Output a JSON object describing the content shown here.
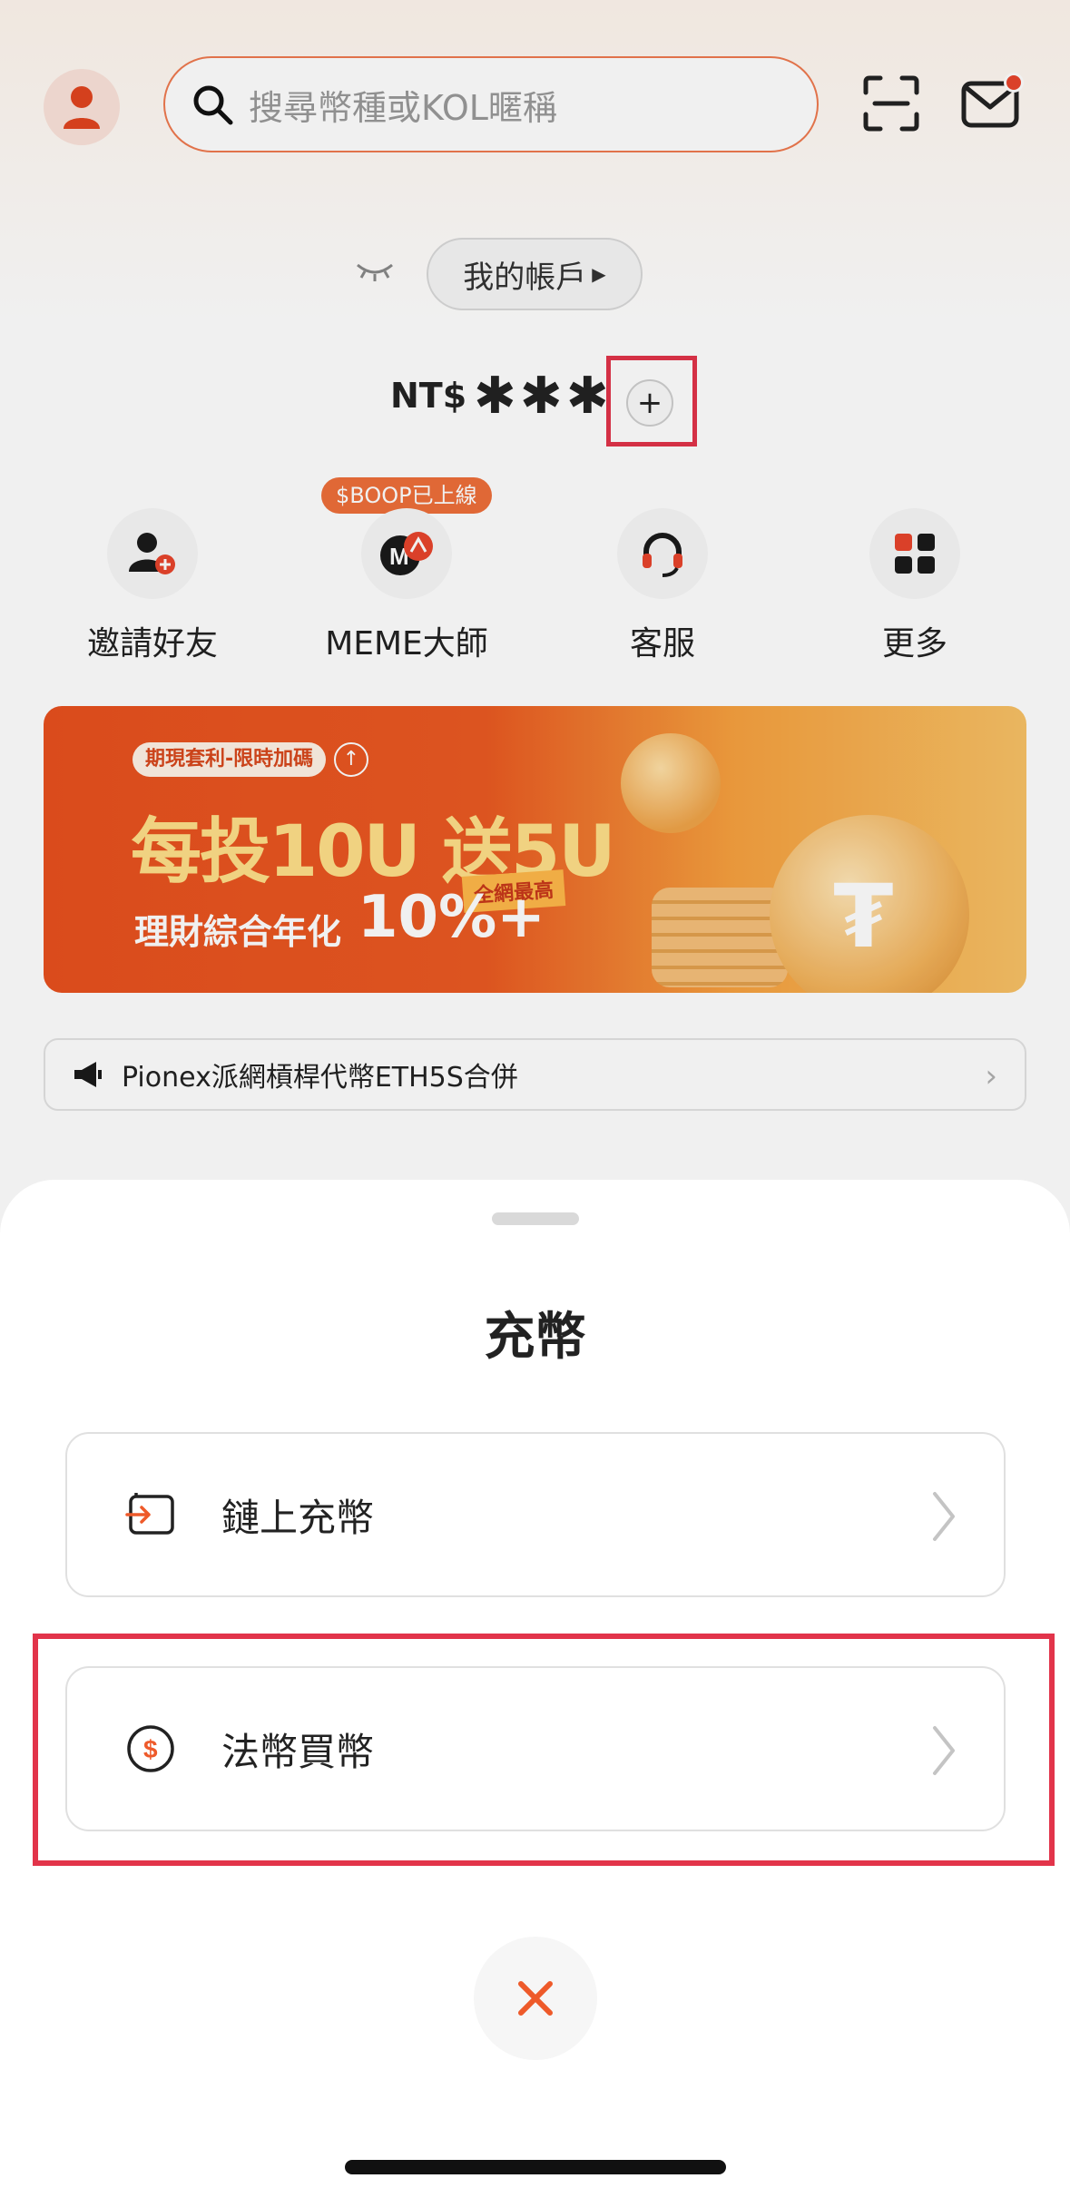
{
  "header": {
    "search_placeholder": "搜尋幣種或KOL暱稱"
  },
  "account": {
    "button_label": "我的帳戶",
    "currency": "NT$",
    "balance_masked": "✱✱✱",
    "plus_symbol": "+"
  },
  "quick_actions": {
    "badge": "$BOOP已上線",
    "items": [
      {
        "label": "邀請好友",
        "icon": "invite-friend-icon"
      },
      {
        "label": "MEME大師",
        "icon": "meme-master-icon"
      },
      {
        "label": "客服",
        "icon": "headset-icon"
      },
      {
        "label": "更多",
        "icon": "grid-icon"
      }
    ]
  },
  "banner": {
    "tag": "期現套利-限時加碼",
    "headline": "每投10U 送5U",
    "badge": "全網最高",
    "subtitle": "理財綜合年化",
    "percent": "10%+"
  },
  "notice": {
    "text": "Pionex派網槓桿代幣ETH5S合併"
  },
  "sheet": {
    "title": "充幣",
    "options": [
      {
        "label": "鏈上充幣",
        "icon": "wallet-deposit-icon"
      },
      {
        "label": "法幣買幣",
        "icon": "dollar-coin-icon"
      }
    ]
  },
  "colors": {
    "accent": "#e8501e",
    "highlight": "#e2344a",
    "close_x": "#ee5a2a"
  }
}
